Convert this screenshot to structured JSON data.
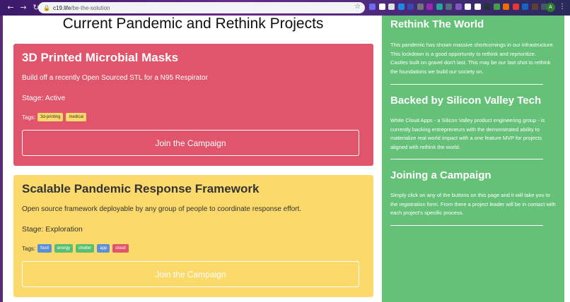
{
  "browser": {
    "url_host": "c19.life",
    "url_path": "/be-the-solution",
    "profile_initial": "A",
    "extension_colors": [
      "#6c6cf0",
      "#ffffff",
      "#e0e0e0",
      "#1e88e5",
      "#3949ab",
      "#757575",
      "#9c27b0",
      "#26a69a",
      "#546e7a",
      "#7e57c2",
      "#ffffff",
      "#ffffff",
      "#263238",
      "#43a047",
      "#ef6c00",
      "#e53935",
      "#1565c0",
      "#5d4037",
      "#455a64"
    ]
  },
  "page": {
    "title": "Current Pandemic and Rethink Projects"
  },
  "projects": [
    {
      "title": "3D Printed Microbial Masks",
      "description": "Build off a recently Open Sourced STL for a N95 Respirator",
      "stage": "Stage: Active",
      "tags_label": "Tags:",
      "tags": [
        {
          "name": "3d-printing"
        },
        {
          "name": "medical"
        }
      ],
      "cta": "Join the Campaign"
    },
    {
      "title": "Scalable Pandemic Response Framework",
      "description": "Open source framework deployable by any group of people to coordinate response effort.",
      "stage": "Stage: Exploration",
      "tags_label": "Tags:",
      "tags": [
        {
          "name": "food",
          "color": "#5b8fd6"
        },
        {
          "name": "energy",
          "color": "#5bbf73"
        },
        {
          "name": "shelter",
          "color": "#5bbf73"
        },
        {
          "name": "app",
          "color": "#5b8fd6"
        },
        {
          "name": "cloud",
          "color": "#e0556b"
        }
      ],
      "cta": "Join the Campaign"
    }
  ],
  "sidebar": {
    "sections": [
      {
        "title": "Rethink The World",
        "paragraphs": [
          "This pandemic has shown massive shortcomings in our infrastructure. This lockdown is a good opportunity to rethink and reprioritize.",
          "Castles built on gravel don't last. This may be our last shot to rethink the foundations we build our society on."
        ]
      },
      {
        "title": "Backed by Silicon Valley Tech",
        "paragraphs": [
          "White Cloud Apps - a Silicon Valley product engineering group - is currently backing entrepreneurs with the demonstrated ability to materialize real world impact with a one feature MVP for projects aligned with rethink the world."
        ]
      },
      {
        "title": "Joining a Campaign",
        "paragraphs": [
          "Simply click on any of the buttons on this page and it will take you to the registration form. From there a project leader will be in contact with each project's specific process."
        ]
      }
    ]
  },
  "colors": {
    "card_red": "#e0556b",
    "card_yellow": "#fbd96b",
    "sidebar_green": "#65c178"
  }
}
